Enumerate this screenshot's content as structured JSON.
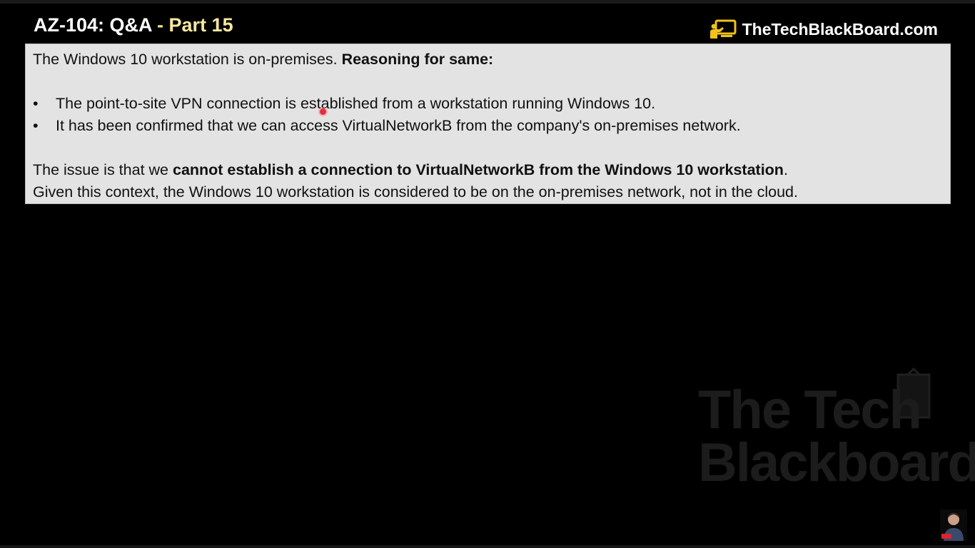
{
  "header": {
    "title_main": "AZ-104: Q&A",
    "title_sep": " - ",
    "title_part": "Part 15",
    "brand_text": "TheTechBlackBoard.com",
    "brand_icon": "blackboard-presenter-icon",
    "brand_icon_color": "#f2c21b"
  },
  "panel": {
    "intro_plain": "The Windows 10 workstation is on-premises. ",
    "intro_bold": "Reasoning for same:",
    "bullets": [
      "The point-to-site VPN connection is established from a workstation running Windows 10.",
      "It has been confirmed that we can access VirtualNetworkB from the company's on-premises network."
    ],
    "bullet_glyph": "•",
    "issue_plain": "The issue is that we ",
    "issue_bold": "cannot establish a connection to VirtualNetworkB from the Windows 10 workstation",
    "issue_end": ".",
    "conclusion": "Given this context, the Windows 10 workstation is considered to be on the on-premises network, not in the cloud."
  },
  "watermark": {
    "line1": "The Tech",
    "line2": "Blackboard"
  },
  "colors": {
    "background": "#000000",
    "panel_bg": "#e3e3e3",
    "title_accent": "#f7e9a0",
    "cursor": "#e0303a"
  }
}
